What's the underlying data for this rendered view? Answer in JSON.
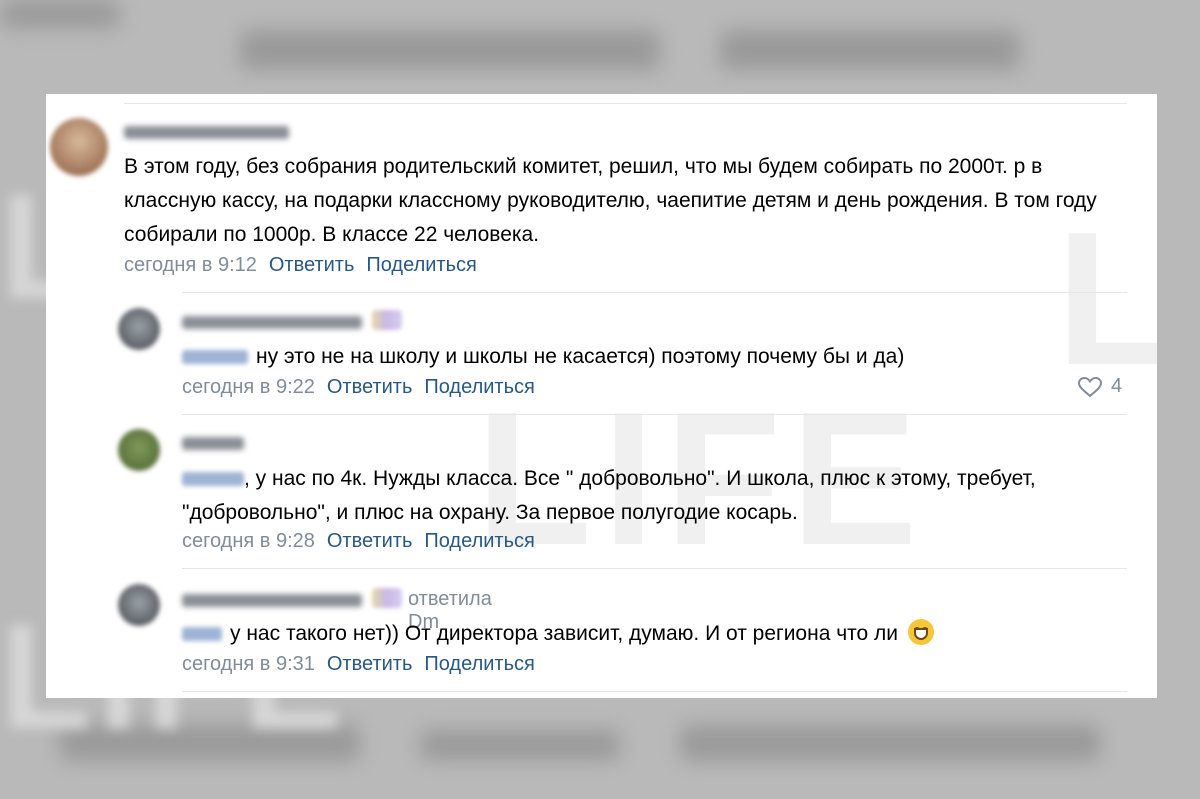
{
  "watermark": "LIFE",
  "comments": [
    {
      "text": "В этом году, без собрания родительский комитет, решил, что мы будем собирать по 2000т. р в классную кассу, на подарки классному руководителю, чаепитие детям и день рождения. В том году собирали по 1000р. В классе 22 человека.",
      "time": "сегодня в 9:12",
      "reply": "Ответить",
      "share": "Поделиться"
    },
    {
      "text": "ну это не на школу и школы не касается) поэтому почему бы и да)",
      "time": "сегодня в 9:22",
      "reply": "Ответить",
      "share": "Поделиться",
      "likes": "4"
    },
    {
      "text": ", у нас по 4к. Нужды класса. Все \" добровольно\". И школа, плюс к этому, требует, \"добровольно\", и плюс на охрану. За первое полугодие косарь.",
      "time": "сегодня в 9:28",
      "reply": "Ответить",
      "share": "Поделиться"
    },
    {
      "replied_to": "ответила Dm",
      "text": "у нас такого нет)) От директора зависит, думаю. И от региона что ли",
      "emoji": "grinning-face",
      "time": "сегодня в 9:31",
      "reply": "Ответить",
      "share": "Поделиться"
    }
  ]
}
